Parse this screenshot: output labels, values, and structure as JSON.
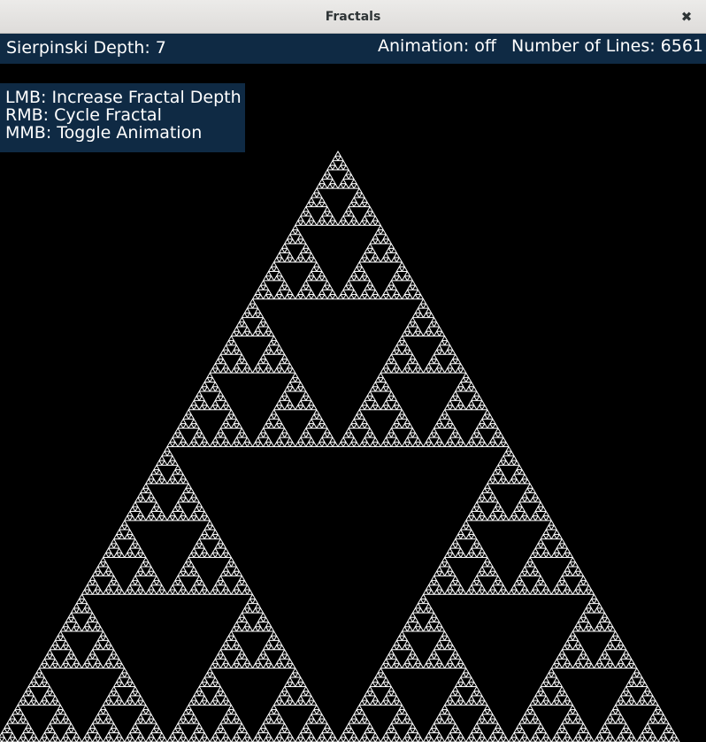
{
  "window": {
    "title": "Fractals",
    "close_icon": "close-icon",
    "close_glyph": "✖"
  },
  "status": {
    "depth_label": "Sierpinski Depth: 7",
    "animation_label": "Animation: off",
    "lines_label": "Number of Lines: 6561"
  },
  "help": {
    "lines": [
      "LMB: Increase Fractal Depth",
      "RMB: Cycle Fractal",
      "MMB: Toggle Animation"
    ]
  },
  "fractal": {
    "type": "sierpinski-triangle",
    "depth": 7,
    "line_count": 6561,
    "animation": false,
    "stroke_color": "#ffffff",
    "background_color": "#000000",
    "panel_color": "#0f2a44"
  }
}
